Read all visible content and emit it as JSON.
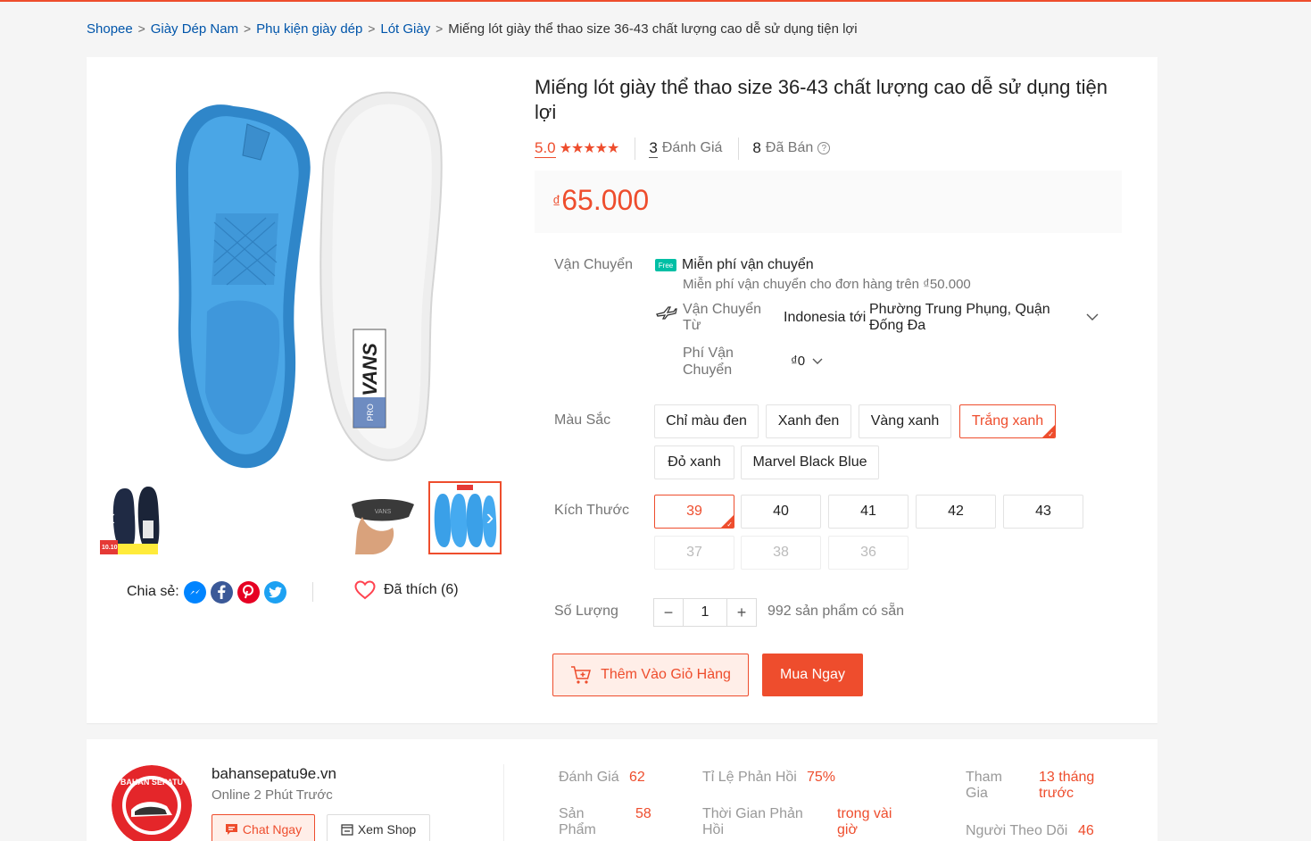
{
  "breadcrumb": {
    "items": [
      "Shopee",
      "Giày Dép Nam",
      "Phụ kiện giày dép",
      "Lót Giày"
    ],
    "current": "Miếng lót giày thể thao size 36-43 chất lượng cao dễ sử dụng tiện lợi",
    "separator": ">"
  },
  "product": {
    "title": "Miếng lót giày thể thao size 36-43 chất lượng cao dễ sử dụng tiện lợi",
    "rating": "5.0",
    "stars": 5,
    "reviews_count": "3",
    "reviews_label": "Đánh Giá",
    "sold_count": "8",
    "sold_label": "Đã Bán",
    "currency": "₫",
    "price": "65.000"
  },
  "gallery": {
    "thumb1_badge": "10.10",
    "thumb4_brand": "VANS"
  },
  "share": {
    "label": "Chia sẻ:",
    "networks": [
      "messenger-icon",
      "facebook-icon",
      "pinterest-icon",
      "twitter-icon"
    ]
  },
  "like": {
    "label": "Đã thích (6)"
  },
  "shipping": {
    "label": "Vận Chuyển",
    "free_badge": "Free",
    "free_title": "Miễn phí vận chuyển",
    "free_note": "Miễn phí vận chuyển cho đơn hàng trên ₫50.000",
    "from_label": "Vận Chuyển Từ",
    "from_value": "Indonesia tới",
    "to_value": "Phường Trung Phụng, Quận Đống Đa",
    "fee_label": "Phí Vận Chuyển",
    "fee_value": "₫0"
  },
  "colors": {
    "label": "Màu Sắc",
    "options": [
      "Chỉ màu đen",
      "Xanh đen",
      "Vàng xanh",
      "Trắng xanh",
      "Đỏ xanh",
      "Marvel Black Blue"
    ],
    "selected": "Trắng xanh"
  },
  "sizes": {
    "label": "Kích Thước",
    "options": [
      "39",
      "40",
      "41",
      "42",
      "43"
    ],
    "disabled": [
      "37",
      "38",
      "36"
    ],
    "selected": "39"
  },
  "quantity": {
    "label": "Số Lượng",
    "minus": "−",
    "value": "1",
    "plus": "+",
    "stock": "992 sản phẩm có sẵn"
  },
  "actions": {
    "add_to_cart": "Thêm Vào Giỏ Hàng",
    "buy_now": "Mua Ngay"
  },
  "shop": {
    "name": "bahansepatu9e.vn",
    "online": "Online 2 Phút Trước",
    "logo_text": "BAHAN SEPATU",
    "chat_label": "Chat Ngay",
    "view_label": "Xem Shop",
    "stats": {
      "ratings_label": "Đánh Giá",
      "ratings_value": "62",
      "products_label": "Sản Phẩm",
      "products_value": "58",
      "response_rate_label": "Tỉ Lệ Phản Hồi",
      "response_rate_value": "75%",
      "response_time_label": "Thời Gian Phản Hồi",
      "response_time_value": "trong vài giờ",
      "joined_label": "Tham Gia",
      "joined_value": "13 tháng trước",
      "followers_label": "Người Theo Dõi",
      "followers_value": "46"
    }
  },
  "theme": {
    "accent": "#ee4d2d",
    "link": "#0055aa",
    "free_ship": "#00bfa5"
  }
}
